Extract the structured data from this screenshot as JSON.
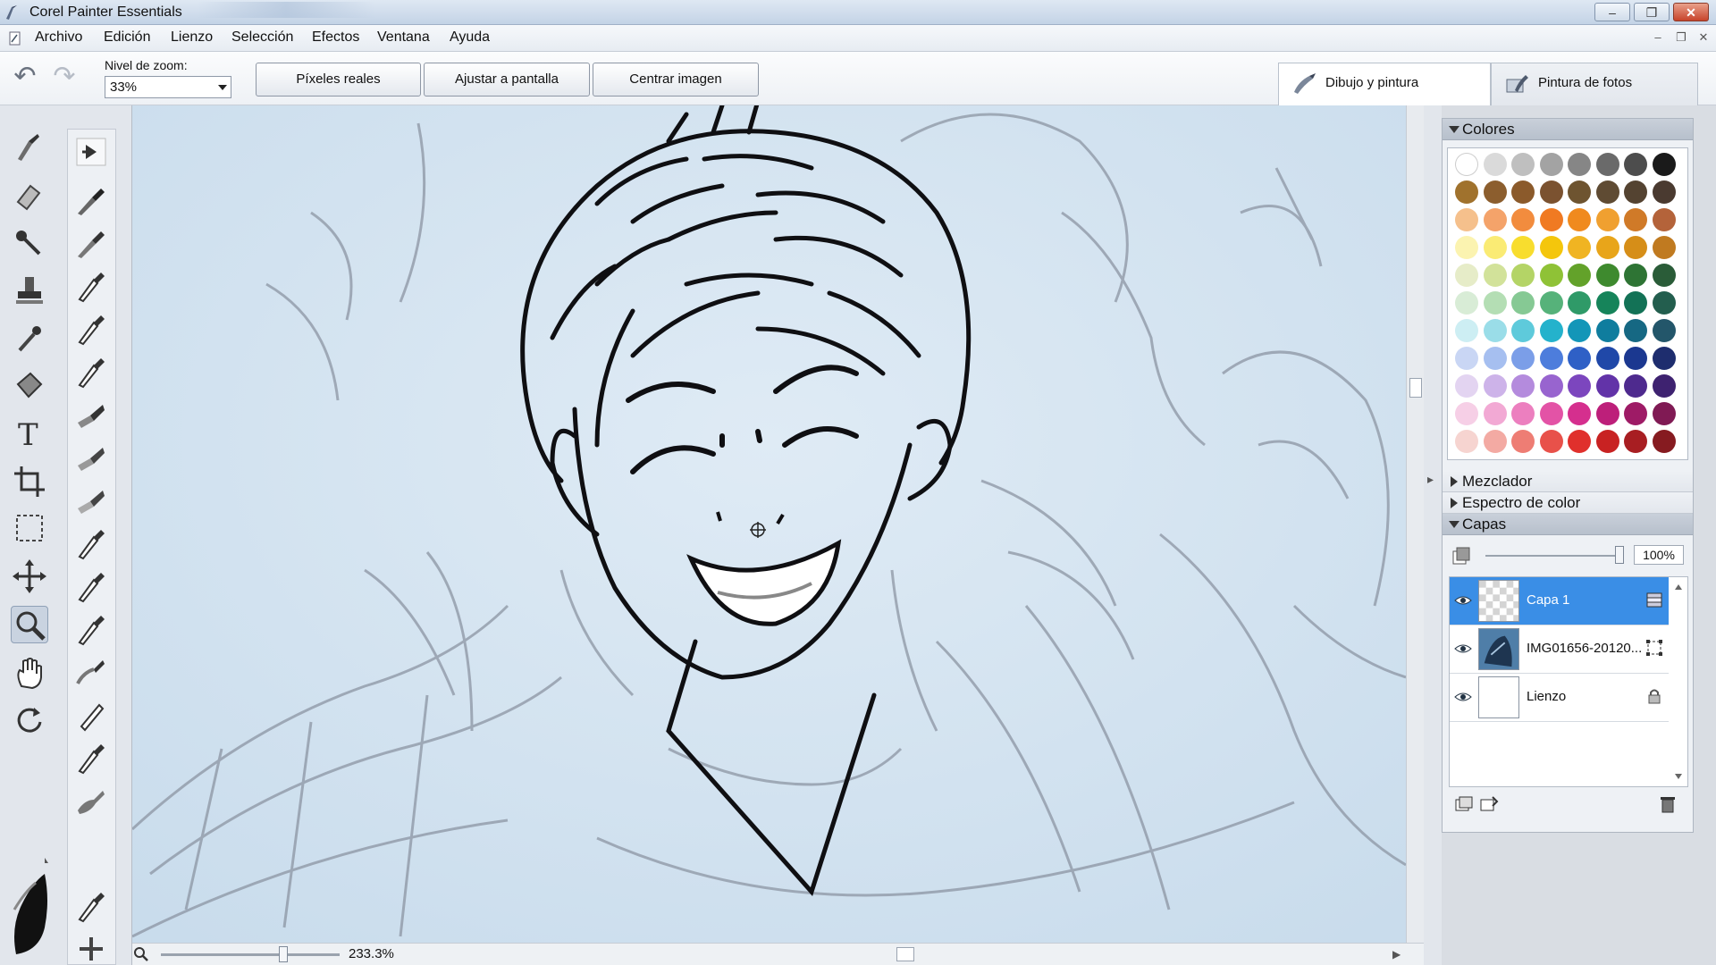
{
  "window": {
    "title": "Corel Painter Essentials",
    "minimize": "–",
    "restore": "❐",
    "close": "✕"
  },
  "menu": {
    "items": [
      "Archivo",
      "Edición",
      "Lienzo",
      "Selección",
      "Efectos",
      "Ventana",
      "Ayuda"
    ]
  },
  "propbar": {
    "zoom_label": "Nivel de zoom:",
    "zoom_value": "33%",
    "buttons": [
      "Píxeles reales",
      "Ajustar a pantalla",
      "Centrar imagen"
    ],
    "workspace_tabs": [
      "Dibujo y pintura",
      "Pintura de fotos"
    ]
  },
  "statusbar": {
    "zoom_pct": "233.3%"
  },
  "panels": {
    "colors_title": "Colores",
    "mixer_title": "Mezclador",
    "spectrum_title": "Espectro de color",
    "layers_title": "Capas",
    "opacity": "100%",
    "swatch_rows": [
      [
        "#ffffff",
        "#dadada",
        "#bfbfbf",
        "#a3a3a3",
        "#868686",
        "#6a6a6a",
        "#4d4d4d",
        "#1a1a1a"
      ],
      [
        "#a0722d",
        "#8c5e2e",
        "#8b5a2b",
        "#7b5230",
        "#6e5430",
        "#5f4b33",
        "#544331",
        "#4a3a30"
      ],
      [
        "#f5c08c",
        "#f4a36a",
        "#f28c3e",
        "#f07a22",
        "#f08a1e",
        "#f0a030",
        "#d07a28",
        "#b4633a"
      ],
      [
        "#fbf3b0",
        "#faeb74",
        "#f8dd2e",
        "#f4c60c",
        "#f0b422",
        "#e8a51a",
        "#d68e18",
        "#c07a20"
      ],
      [
        "#e6ecc8",
        "#d2e29a",
        "#b4d466",
        "#8fc236",
        "#63a22a",
        "#3e8a2e",
        "#2e7434",
        "#2a5c38"
      ],
      [
        "#d8ecd6",
        "#b4deb4",
        "#86c994",
        "#56b27a",
        "#2f9a68",
        "#16845a",
        "#137256",
        "#235e4e"
      ],
      [
        "#cdeef3",
        "#9adde8",
        "#5ecadb",
        "#24b2cc",
        "#1396b8",
        "#0f7d9e",
        "#166883",
        "#23566a"
      ],
      [
        "#c9d6f4",
        "#a6bff0",
        "#7b9ee8",
        "#4d7ddc",
        "#2f60c6",
        "#2048a8",
        "#1b3890",
        "#1e2d6e"
      ],
      [
        "#e3d4f1",
        "#cdb3e9",
        "#b48bdd",
        "#9864cf",
        "#7c46be",
        "#6233a8",
        "#4e2a8e",
        "#3e2270"
      ],
      [
        "#f6cfe6",
        "#f2a9d4",
        "#ec7fbf",
        "#e353a6",
        "#d52f8e",
        "#bd1f7a",
        "#9e1b66",
        "#801a54"
      ],
      [
        "#f6d4d0",
        "#f3aaa3",
        "#ee7d74",
        "#e8514a",
        "#e0302c",
        "#c82222",
        "#a81e22",
        "#861b20"
      ]
    ],
    "layers": [
      {
        "name": "Capa 1"
      },
      {
        "name": "IMG01656-20120..."
      },
      {
        "name": "Lienzo"
      }
    ]
  },
  "icons": {
    "undo": "↶",
    "redo": "↷",
    "expand_left": "▸"
  }
}
